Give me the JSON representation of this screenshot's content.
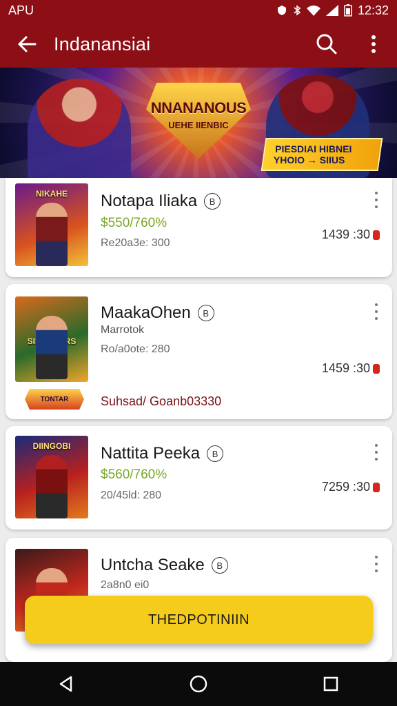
{
  "status_bar": {
    "left_text": "APU",
    "time": "12:32",
    "icons": [
      "shield-icon",
      "bluetooth-icon",
      "wifi-icon",
      "signal-icon",
      "battery-icon"
    ]
  },
  "app_bar": {
    "title": "Indanansiai",
    "back_icon": "arrow-left-icon",
    "search_icon": "search-icon",
    "menu_icon": "more-vertical-icon"
  },
  "banner": {
    "logo_title": "NNANANOUS",
    "logo_sub": "UEHE  IIENBIC",
    "promo_line1": "PIESDIAI  HIBNEI",
    "promo_line2": "YHOIO  → SIIUS"
  },
  "items": [
    {
      "thumb_label": "NIKAHE",
      "name": "Notapa Iliaka",
      "badge": "B",
      "price": "$550/760%",
      "meta": "Re20a3e: 300",
      "time": "1439 :30",
      "colors": [
        "#6a1a8a",
        "#d8531e",
        "#f2c23a"
      ]
    },
    {
      "thumb_label": "SIENBNHRS",
      "name": "MaakaOhen",
      "badge": "B",
      "subline": "Marrotok",
      "meta": "Ro/a0ote: 280",
      "time": "1459 :30",
      "link_text": "Suhsad/ Goanb03330",
      "mini_logo": "TONTAR",
      "colors": [
        "#d86a1e",
        "#2a6a2a",
        "#f2a52a"
      ]
    },
    {
      "thumb_label": "DIINGOBI",
      "name": "Nattita Peeka",
      "badge": "B",
      "price": "$560/760%",
      "meta": "20/45ld: 280",
      "time": "7259 :30",
      "colors": [
        "#1a2a7a",
        "#b8201e",
        "#e37a1e"
      ]
    },
    {
      "thumb_label": "",
      "name": "Untcha Seake",
      "badge": "B",
      "meta": "2a8n0 ei0",
      "time": "",
      "colors": [
        "#3a1a1a",
        "#c2281e",
        "#e38a1e"
      ]
    }
  ],
  "cta": {
    "label": "THEDPOTINIIN"
  },
  "nav_bar": {
    "buttons": [
      "back-triangle-icon",
      "home-circle-icon",
      "recents-square-icon"
    ]
  }
}
